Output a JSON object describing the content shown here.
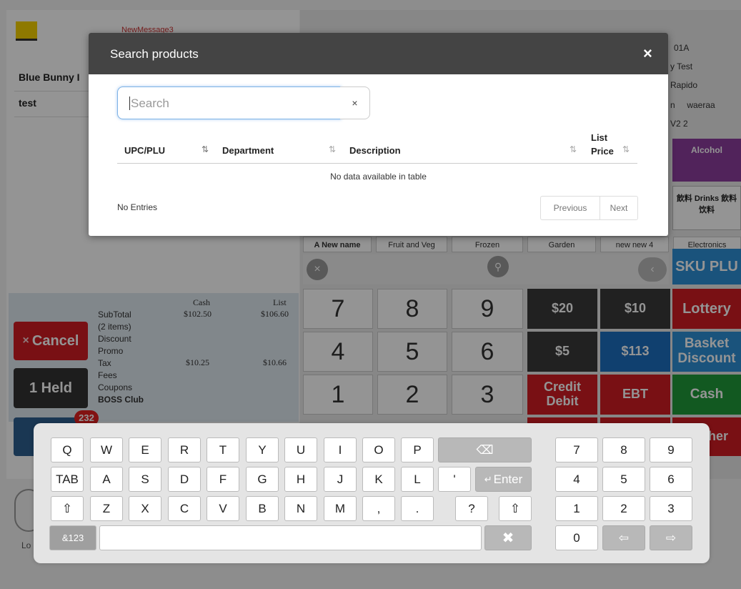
{
  "app": {
    "new_message": "NewMessage3",
    "cart_items": [
      "Blue Bunny I",
      "test"
    ],
    "totals": {
      "col_cash": "Cash",
      "col_list": "List",
      "labels": [
        "SubTotal",
        "(2 items)",
        "Discount",
        "Promo",
        "Tax",
        "Fees",
        "Coupons",
        "BOSS Club"
      ],
      "subtotal_cash": "$102.50",
      "subtotal_list": "$106.60",
      "tax_cash": "$10.25",
      "tax_list": "$10.66"
    },
    "cancel_label": "Cancel",
    "held_label": "1 Held",
    "badge_count": "232",
    "right_info": [
      "01A",
      "y Test",
      "Rapido",
      "n     waeraa",
      "V2 2"
    ],
    "alcohol_label": "Alcohol",
    "drinks_label": "飲料 Drinks 飲料 饮料",
    "categories": [
      "A New name",
      "Fruit and Veg",
      "Frozen",
      "Garden",
      "new new 4",
      "Electronics"
    ],
    "sku_label": "SKU PLU",
    "numpad": [
      "7",
      "8",
      "9",
      "4",
      "5",
      "6",
      "1",
      "2",
      "3"
    ],
    "function_keys": {
      "k20": "$20",
      "k10": "$10",
      "lottery": "Lottery",
      "k5": "$5",
      "k113": "$113",
      "basket": "Basket Discount",
      "credit": "Credit Debit",
      "ebt": "EBT",
      "cash": "Cash",
      "other": "her"
    },
    "bottom_left": "Lo"
  },
  "modal": {
    "title": "Search products",
    "close_icon": "×",
    "search_placeholder": "Search",
    "clear_icon": "×",
    "columns": [
      "UPC/PLU",
      "Department",
      "Description",
      "List Price"
    ],
    "list_price_line1": "List",
    "list_price_line2": "Price",
    "empty_message": "No data available in table",
    "entries_label": "No Entries",
    "previous_label": "Previous",
    "next_label": "Next"
  },
  "keyboard": {
    "row1": [
      "Q",
      "W",
      "E",
      "R",
      "T",
      "Y",
      "U",
      "I",
      "O",
      "P"
    ],
    "row2": [
      "A",
      "S",
      "D",
      "F",
      "G",
      "H",
      "J",
      "K",
      "L",
      "'"
    ],
    "row3": [
      "Z",
      "X",
      "C",
      "V",
      "B",
      "N",
      "M",
      ",",
      ".",
      "?"
    ],
    "tab_label": "TAB",
    "enter_label": "Enter",
    "symbols_label": "&123",
    "numpad": [
      "7",
      "8",
      "9",
      "4",
      "5",
      "6",
      "1",
      "2",
      "3",
      "0"
    ]
  }
}
